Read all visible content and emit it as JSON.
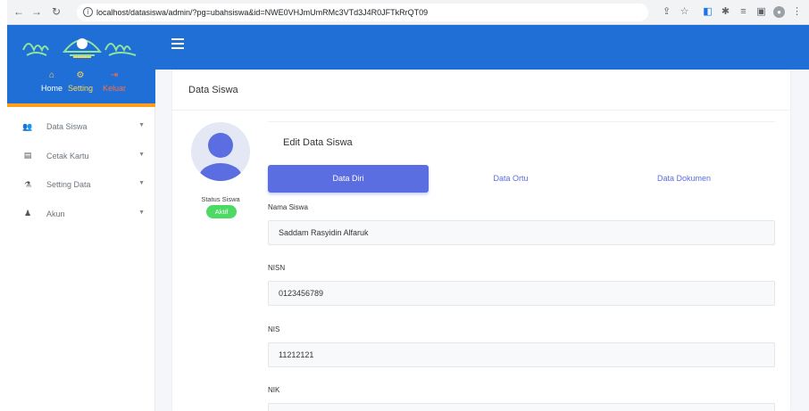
{
  "browser": {
    "url": "localhost/datasiswa/admin/?pg=ubahsiswa&id=NWE0VHJmUmRMc3VTd3J4R0JFTkRrQT09"
  },
  "sidebar": {
    "quick_links": [
      {
        "label": "Home",
        "icon": "home-icon",
        "color": "#ffd54f"
      },
      {
        "label": "Setting",
        "icon": "user-cog-icon",
        "color": "#ffd54f"
      },
      {
        "label": "Keluar",
        "icon": "sign-out-icon",
        "color": "#ff7043"
      }
    ],
    "items": [
      {
        "label": "Data Siswa",
        "icon": "users-icon"
      },
      {
        "label": "Cetak Kartu",
        "icon": "id-card-icon"
      },
      {
        "label": "Setting Data",
        "icon": "flask-icon"
      },
      {
        "label": "Akun",
        "icon": "user-icon"
      }
    ]
  },
  "page": {
    "title": "Data Siswa"
  },
  "profile": {
    "status_label": "Status Siswa",
    "status_badge": "Aktif"
  },
  "edit": {
    "title": "Edit Data Siswa",
    "tabs": [
      {
        "label": "Data Diri",
        "active": true
      },
      {
        "label": "Data Ortu",
        "active": false
      },
      {
        "label": "Data Dokumen",
        "active": false
      }
    ],
    "fields": [
      {
        "label": "Nama Siswa",
        "value": "Saddam Rasyidin Alfaruk"
      },
      {
        "label": "NISN",
        "value": "0123456789"
      },
      {
        "label": "NIS",
        "value": "11212121"
      },
      {
        "label": "NIK",
        "value": ""
      }
    ]
  },
  "colors": {
    "header_blue": "#1f6fd6",
    "accent_orange": "#ff9f1c",
    "tab_active": "#5b6ee1",
    "badge_green": "#4cd964"
  }
}
